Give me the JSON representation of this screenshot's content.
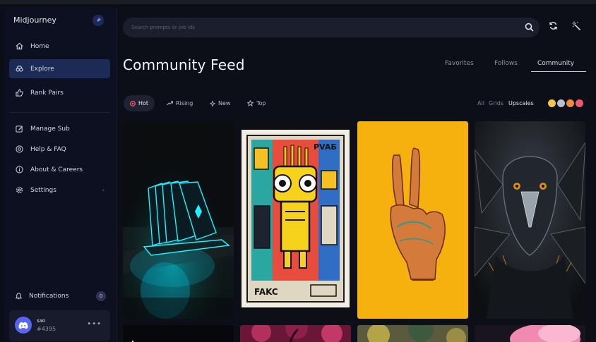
{
  "app": {
    "brand": "Midjourney"
  },
  "sidebar": {
    "items": [
      {
        "label": "Home",
        "icon": "home-icon"
      },
      {
        "label": "Explore",
        "icon": "explore-icon",
        "active": true
      },
      {
        "label": "Rank Pairs",
        "icon": "thumbs-up-icon"
      }
    ],
    "items2": [
      {
        "label": "Manage Sub",
        "icon": "edit-icon"
      },
      {
        "label": "Help & FAQ",
        "icon": "help-icon"
      },
      {
        "label": "About & Careers",
        "icon": "info-icon"
      },
      {
        "label": "Settings",
        "icon": "gear-icon"
      }
    ],
    "notifications": {
      "label": "Notifications",
      "count": "0"
    },
    "user": {
      "name": "sao",
      "tag": "#4395",
      "more": "•••"
    }
  },
  "search": {
    "placeholder": "Search prompts or job ids"
  },
  "header": {
    "title": "Community Feed",
    "tabs": [
      "Favorites",
      "Follows",
      "Community"
    ],
    "active_tab": "Community"
  },
  "filters": {
    "chips": [
      {
        "label": "Hot",
        "icon": "fire-icon",
        "active": true
      },
      {
        "label": "Rising",
        "icon": "trending-icon"
      },
      {
        "label": "New",
        "icon": "sparkle-icon"
      },
      {
        "label": "Top",
        "icon": "star-icon"
      }
    ],
    "view_options": [
      "All",
      "Grids",
      "Upscales"
    ],
    "active_view": "Upscales",
    "reactions": [
      "#f4c542",
      "#b8bfd0",
      "#f08a3c",
      "#ef5a6f"
    ]
  },
  "colors": {
    "accent": "#5865f2",
    "active_nav_bg": "#1b2b55"
  },
  "feed": {
    "images": [
      {
        "name": "glowing-cards-image"
      },
      {
        "name": "robot-stamp-image",
        "stamp_text_top": "PVAБ",
        "stamp_text_bottom": "FAKC"
      },
      {
        "name": "peace-hand-image"
      },
      {
        "name": "raven-image"
      },
      {
        "name": "feed-image-5"
      },
      {
        "name": "feed-image-6"
      },
      {
        "name": "feed-image-7"
      },
      {
        "name": "feed-image-8"
      }
    ]
  }
}
